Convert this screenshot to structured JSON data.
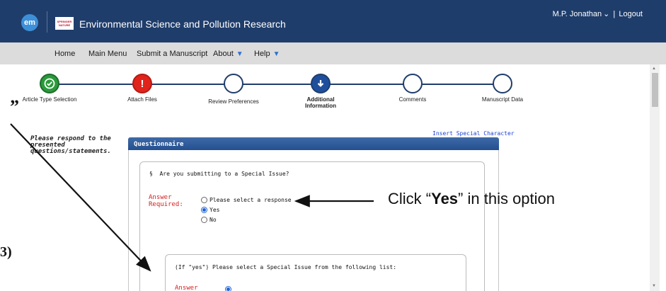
{
  "header": {
    "logo_text": "em",
    "publisher_logo_text": "SPRINGER NATURE",
    "journal_title": "Environmental Science and Pollution Research",
    "user_name": "M.P. Jonathan",
    "separator": "|",
    "logout_label": "Logout",
    "background_color": "#1f3d6b"
  },
  "nav": {
    "items": [
      {
        "label": "Home"
      },
      {
        "label": "Main Menu"
      },
      {
        "label": "Submit a Manuscript"
      },
      {
        "label": "About"
      },
      {
        "label": "Help"
      }
    ]
  },
  "steps": [
    {
      "label": "Article Type Selection",
      "state": "done",
      "icon": "check-icon"
    },
    {
      "label": "Attach Files",
      "state": "error",
      "icon": "exclamation-icon"
    },
    {
      "label": "Review Preferences",
      "state": "pending",
      "icon": "circle-icon"
    },
    {
      "label": "Additional Information",
      "state": "current",
      "icon": "down-arrow-icon"
    },
    {
      "label": "Comments",
      "state": "pending",
      "icon": "circle-icon"
    },
    {
      "label": "Manuscript Data",
      "state": "pending",
      "icon": "circle-icon"
    }
  ],
  "sidebar": {
    "note": "Please respond to the presented questions/statements.",
    "fragment_quote": "”",
    "fragment_paren": "3)"
  },
  "questionnaire": {
    "insert_special_character": "Insert Special Character",
    "header": "Questionnaire",
    "question_bullet": "§",
    "question": "Are you submitting to a Special Issue?",
    "answer_required": "Answer Required:",
    "options": [
      {
        "label": "Please select a response",
        "checked": false
      },
      {
        "label": "Yes",
        "checked": true
      },
      {
        "label": "No",
        "checked": false
      }
    ],
    "sub_question": "(If \"yes\") Please select a Special Issue from the following list:",
    "sub_answer_required": "Answer"
  },
  "annotation": {
    "prefix": "Click “",
    "bold": "Yes",
    "suffix": "” in this option"
  }
}
